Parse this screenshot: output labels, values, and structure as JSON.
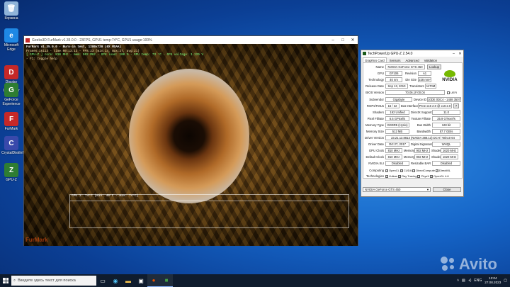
{
  "desktop": {
    "icons": [
      {
        "label": "Корзина",
        "glyph": "🗑",
        "color": "#8fb4d9"
      },
      {
        "label": "Microsoft Edge",
        "glyph": "e",
        "color": "#1e88e5"
      },
      {
        "label": "Display Driver Uninstaller",
        "glyph": "D",
        "color": "#c62828"
      },
      {
        "label": "GeForce Experience",
        "glyph": "G",
        "color": "#2e7d32"
      },
      {
        "label": "FurMark",
        "glyph": "F",
        "color": "#c62828"
      },
      {
        "label": "CrystalDiskInfo",
        "glyph": "C",
        "color": "#3949ab"
      },
      {
        "label": "GPU-Z",
        "glyph": "Z",
        "color": "#2e7d32"
      }
    ]
  },
  "furmark": {
    "title": "Geeks3D FurMark v1.35.0.0 - 23FPS, GPU1 temp:74°C, GPU1 usage:100%",
    "hud": {
      "line1": "FurMark v1.35.0.0 - Burn-in test, 1280x720 (0X MSAA)",
      "line2": "Frames:16113 - time:00:13:13 - FPS:23 (min:14, max:27, avg:21)",
      "line3": "[ GPU-Z ] core: 810 MHz - mem: 902 MHz - GPU load: 100 % - GPU temp: 73 °C - GPU voltage: 1.125 V",
      "line4": "- F1: toggle help"
    },
    "graph_label": "GPU 1: 74°C (min: 40°C - max: 74°C)",
    "logo": "FurMark"
  },
  "gpuz": {
    "title": "TechPowerUp GPU-Z 2.54.0",
    "tabs": [
      "Graphics Card",
      "Sensors",
      "Advanced",
      "Validation"
    ],
    "fields": {
      "name": {
        "label": "Name",
        "value": "NVIDIA GeForce GTS 450",
        "button": "Lookup"
      },
      "gpu": {
        "label": "GPU",
        "value": "GF106",
        "label2": "Revision",
        "value2": "A1"
      },
      "technology": {
        "label": "Technology",
        "value": "40 nm",
        "label2": "Die Size",
        "value2": "228 mm²"
      },
      "release": {
        "label": "Release Date",
        "value": "Sep 13, 2010",
        "label2": "Transistors",
        "value2": "1170M"
      },
      "bios": {
        "label": "BIOS Version",
        "value": "70.06.1F.00.04",
        "uefi": "UEFI"
      },
      "subvendor": {
        "label": "Subvendor",
        "value": "Gigabyte",
        "label2": "Device ID",
        "value2": "10DE 0DC4 - 1458 3507"
      },
      "rops": {
        "label": "ROPs/TMUs",
        "value": "16 / 32",
        "label2": "Bus Interface",
        "value2": "PCIe x16 2.0 @ x16 2.0",
        "help": "?"
      },
      "shaders": {
        "label": "Shaders",
        "value": "192 Unified",
        "label2": "DirectX Support",
        "value2": "11.0"
      },
      "pixel": {
        "label": "Pixel Fillrate",
        "value": "6.5 GPixel/s",
        "label2": "Texture Fillrate",
        "value2": "25.9 GTexel/s"
      },
      "memtype": {
        "label": "Memory Type",
        "value": "GDDR5 (Hynix)",
        "label2": "Bus Width",
        "value2": "128 bit"
      },
      "memsize": {
        "label": "Memory Size",
        "value": "512 MB",
        "label2": "Bandwidth",
        "value2": "57.7 GB/s"
      },
      "driver": {
        "label": "Driver Version",
        "value": "23.21.13.8813 (NVIDIA 388.13) DCH / Win10 64"
      },
      "driverdate": {
        "label": "Driver Date",
        "value": "Oct 27, 2017",
        "label2": "Digital Signature",
        "value2": "WHQL"
      },
      "gpuclock": {
        "label": "GPU Clock",
        "value": "810 MHz",
        "label2": "Memory",
        "value2": "902 MHz",
        "label3": "Shader",
        "value3": "1620 MHz"
      },
      "defclock": {
        "label": "Default Clock",
        "value": "810 MHz",
        "label2": "Memory",
        "value2": "902 MHz",
        "label3": "Shader",
        "value3": "1620 MHz"
      },
      "sli": {
        "label": "NVIDIA SLI",
        "value": "Disabled",
        "label2": "Resizable BAR",
        "value2": "Disabled"
      }
    },
    "computing": {
      "label": "Computing",
      "items": [
        "OpenCL",
        "CUDA",
        "DirectCompute",
        "DirectML"
      ]
    },
    "technologies": {
      "label": "Technologies",
      "items": [
        "Vulkan",
        "Ray Tracing",
        "PhysX",
        "OpenGL 4.6"
      ]
    },
    "selected_gpu": "NVIDIA GeForce GTS 450",
    "close_label": "Close",
    "brand": "NVIDIA"
  },
  "watermark": "Avito",
  "taskbar": {
    "search_placeholder": "Введите здесь текст для поиска",
    "lang": "ENG",
    "time": "12:04",
    "date": "27.08.2023"
  }
}
